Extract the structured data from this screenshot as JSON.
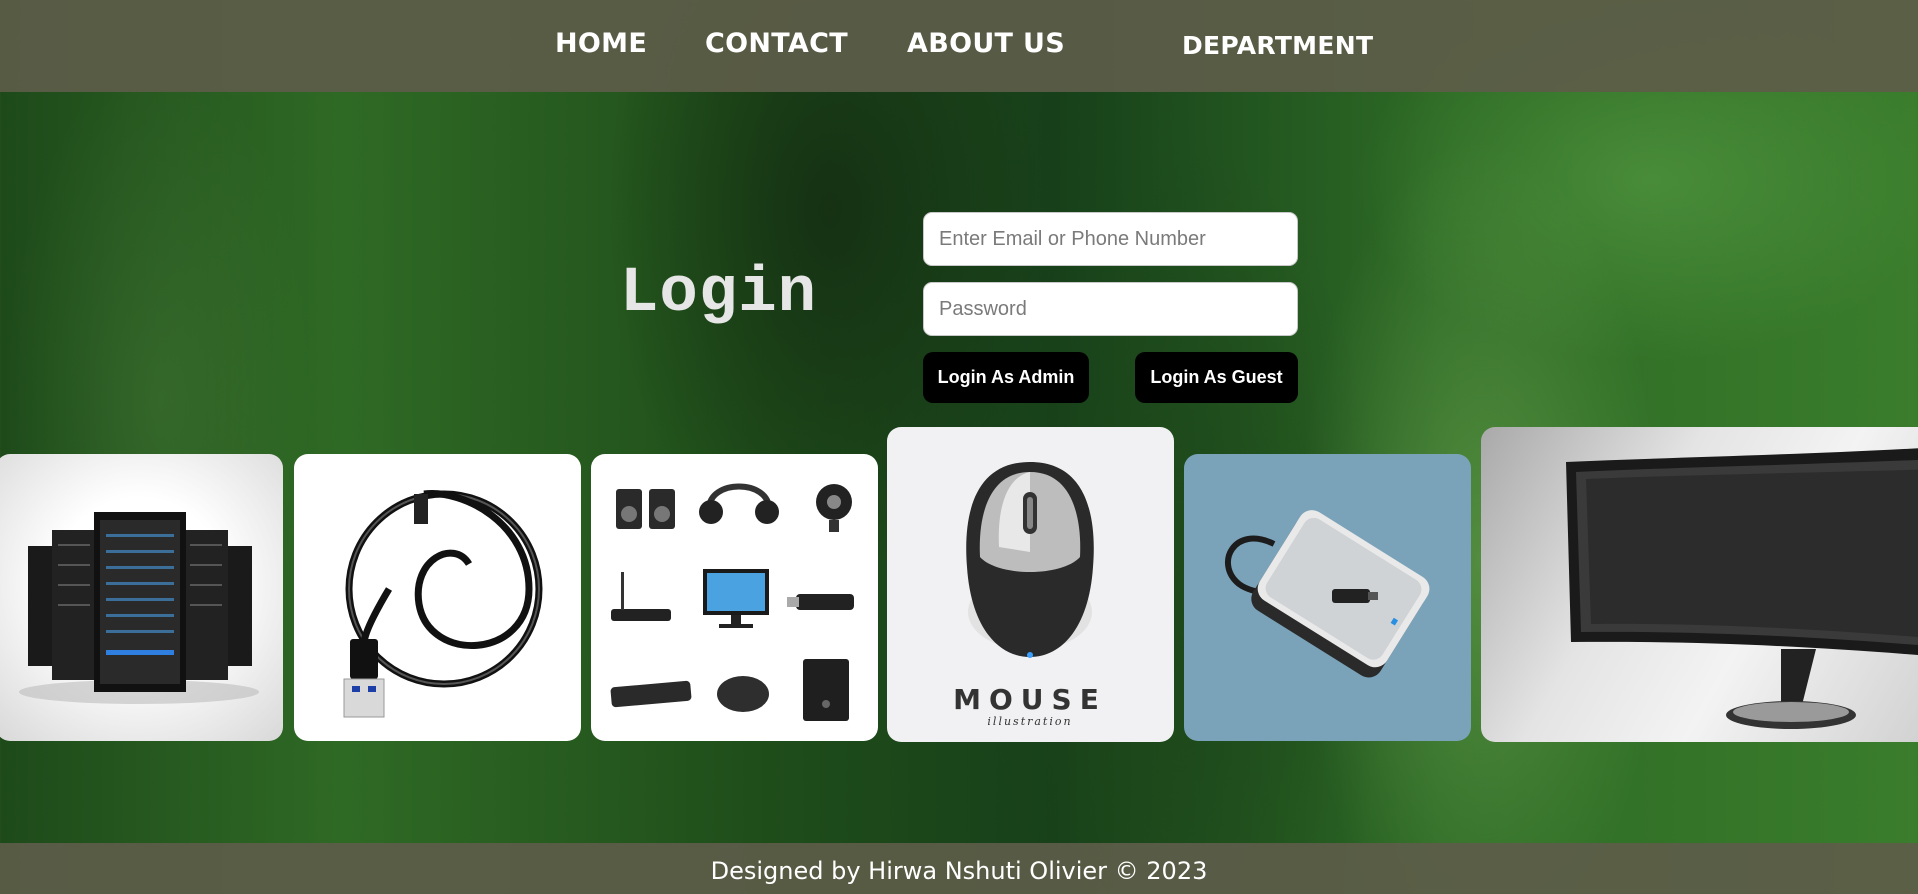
{
  "nav": {
    "home": "HOME",
    "contact": "CONTACT",
    "about": "ABOUT US",
    "department": "DEPARTMENT"
  },
  "login": {
    "title": "Login",
    "email_placeholder": "Enter Email or Phone Number",
    "email_value": "",
    "password_placeholder": "Password",
    "password_value": "",
    "admin_button": "Login As Admin",
    "guest_button": "Login As Guest"
  },
  "gallery": {
    "items": [
      {
        "icon": "server-rack-icon"
      },
      {
        "icon": "usb-cable-icon"
      },
      {
        "icon": "computer-accessories-icon"
      },
      {
        "icon": "mouse-icon",
        "caption": "MOUSE",
        "subcaption": "illustration"
      },
      {
        "icon": "external-hard-drive-icon"
      },
      {
        "icon": "curved-monitor-icon"
      }
    ]
  },
  "footer": {
    "text": "Designed by Hirwa Nshuti Olivier © 2023"
  },
  "colors": {
    "header_bg": "#5c5c48",
    "button_bg": "#000000",
    "background_green": "#2f6a25"
  }
}
